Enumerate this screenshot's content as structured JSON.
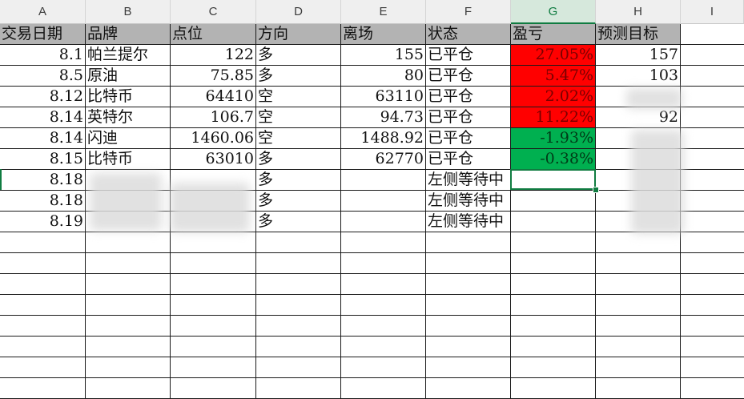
{
  "columns": [
    "A",
    "B",
    "C",
    "D",
    "E",
    "F",
    "G",
    "H",
    "I"
  ],
  "selected_column": "G",
  "headers": [
    "交易日期",
    "品牌",
    "点位",
    "方向",
    "离场",
    "状态",
    "盈亏",
    "预测目标"
  ],
  "rows": [
    {
      "date": "8.1",
      "brand": "帕兰提尔",
      "price": "122",
      "dir": "多",
      "exit": "155",
      "status": "已平仓",
      "pnl": "27.05%",
      "pnl_color": "red",
      "target": "157"
    },
    {
      "date": "8.5",
      "brand": "原油",
      "price": "75.85",
      "dir": "多",
      "exit": "80",
      "status": "已平仓",
      "pnl": "5.47%",
      "pnl_color": "red",
      "target": "103"
    },
    {
      "date": "8.12",
      "brand": "比特币",
      "price": "64410",
      "dir": "空",
      "exit": "63110",
      "status": "已平仓",
      "pnl": "2.02%",
      "pnl_color": "red",
      "target": ""
    },
    {
      "date": "8.14",
      "brand": "英特尔",
      "price": "106.7",
      "dir": "空",
      "exit": "94.73",
      "status": "已平仓",
      "pnl": "11.22%",
      "pnl_color": "red",
      "target": "92"
    },
    {
      "date": "8.14",
      "brand": "闪迪",
      "price": "1460.06",
      "dir": "空",
      "exit": "1488.92",
      "status": "已平仓",
      "pnl": "-1.93%",
      "pnl_color": "green",
      "target": ""
    },
    {
      "date": "8.15",
      "brand": "比特币",
      "price": "63010",
      "dir": "多",
      "exit": "62770",
      "status": "已平仓",
      "pnl": "-0.38%",
      "pnl_color": "green",
      "target": ""
    },
    {
      "date": "8.18",
      "brand": "",
      "price": "",
      "dir": "多",
      "exit": "",
      "status": "左侧等待中",
      "pnl": "",
      "pnl_color": "",
      "target": ""
    },
    {
      "date": "8.18",
      "brand": "",
      "price": "",
      "dir": "多",
      "exit": "",
      "status": "左侧等待中",
      "pnl": "",
      "pnl_color": "",
      "target": ""
    },
    {
      "date": "8.19",
      "brand": "",
      "price": "",
      "dir": "多",
      "exit": "",
      "status": "左侧等待中",
      "pnl": "",
      "pnl_color": "",
      "target": ""
    }
  ],
  "colors": {
    "loss_green": "#00b050",
    "gain_red": "#ff0000",
    "header_gray": "#b3b3b3",
    "accent": "#107c41"
  }
}
